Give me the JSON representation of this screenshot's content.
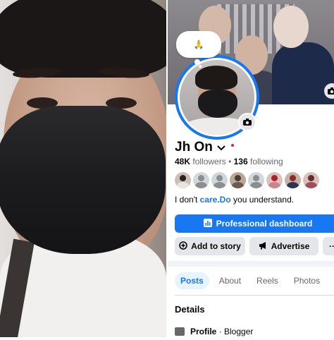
{
  "note": {
    "emoji": "🙏"
  },
  "profile": {
    "name": "Jh On",
    "followers_count": "48K",
    "followers_label": "followers",
    "separator": "•",
    "following_count": "136",
    "following_label": "following",
    "bio_prefix": "I don't ",
    "bio_link": "care.Do",
    "bio_suffix": " you understand."
  },
  "buttons": {
    "professional_dashboard": "Professional dashboard",
    "add_to_story": "Add to story",
    "advertise": "Advertise",
    "more": "···"
  },
  "tabs": [
    {
      "label": "Posts",
      "active": true
    },
    {
      "label": "About",
      "active": false
    },
    {
      "label": "Reels",
      "active": false
    },
    {
      "label": "Photos",
      "active": false
    }
  ],
  "details": {
    "title": "Details",
    "profile_label": "Profile",
    "profile_separator": " · ",
    "profile_category": "Blogger"
  },
  "icons": {
    "camera": "camera-icon",
    "chevron": "chevron-down-icon",
    "dashboard": "chart-icon",
    "add_story": "plus-circle-icon",
    "advertise": "megaphone-icon",
    "details": "info-card-icon"
  },
  "colors": {
    "accent": "#1877f2",
    "secondary_button": "#e4e6eb",
    "muted_text": "#65676b",
    "notification_dot": "#e41e3f"
  }
}
